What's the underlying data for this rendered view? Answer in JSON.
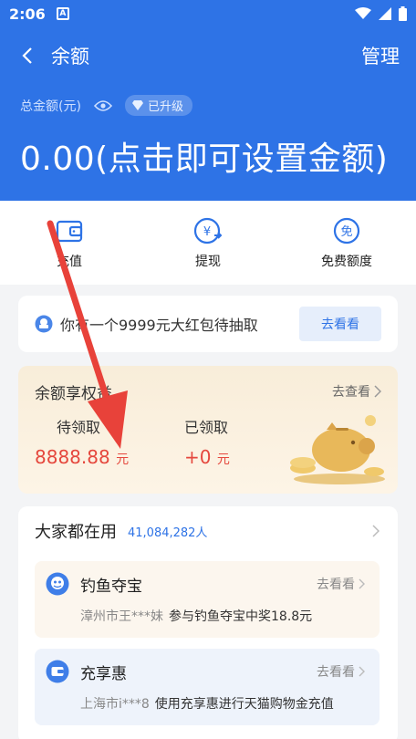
{
  "status_bar": {
    "time": "2:06",
    "sim_label": "A"
  },
  "nav": {
    "title": "余额",
    "manage_label": "管理"
  },
  "balance": {
    "total_label": "总金额(元)",
    "badge_label": "已升级",
    "amount_text": "0.00(点击即可设置金额)"
  },
  "actions": [
    {
      "label": "充值",
      "icon": "wallet-icon"
    },
    {
      "label": "提现",
      "icon": "withdraw-icon"
    },
    {
      "label": "免费额度",
      "icon": "free-quota-icon"
    }
  ],
  "promo": {
    "text": "你有一个9999元大红包待抽取",
    "button_label": "去看看"
  },
  "benefit": {
    "title": "余额享权益",
    "more_label": "去查看",
    "pending_label": "待领取",
    "pending_value": "8888.88",
    "pending_unit": "元",
    "received_label": "已领取",
    "received_value": "+0",
    "received_unit": "元"
  },
  "people": {
    "title": "大家都在用",
    "count": "41,084,282人",
    "items": [
      {
        "title": "钓鱼夺宝",
        "more_label": "去看看",
        "user": "漳州市王***妹",
        "desc": "参与钓鱼夺宝中奖18.8元",
        "icon": "fishing-icon"
      },
      {
        "title": "充享惠",
        "more_label": "去看看",
        "user": "上海市i***8",
        "desc": "使用充享惠进行天猫购物金充值",
        "icon": "recharge-icon"
      }
    ]
  },
  "colors": {
    "primary": "#2e73e6",
    "accent_red": "#e5473d",
    "annotation_arrow": "#e8423a"
  }
}
